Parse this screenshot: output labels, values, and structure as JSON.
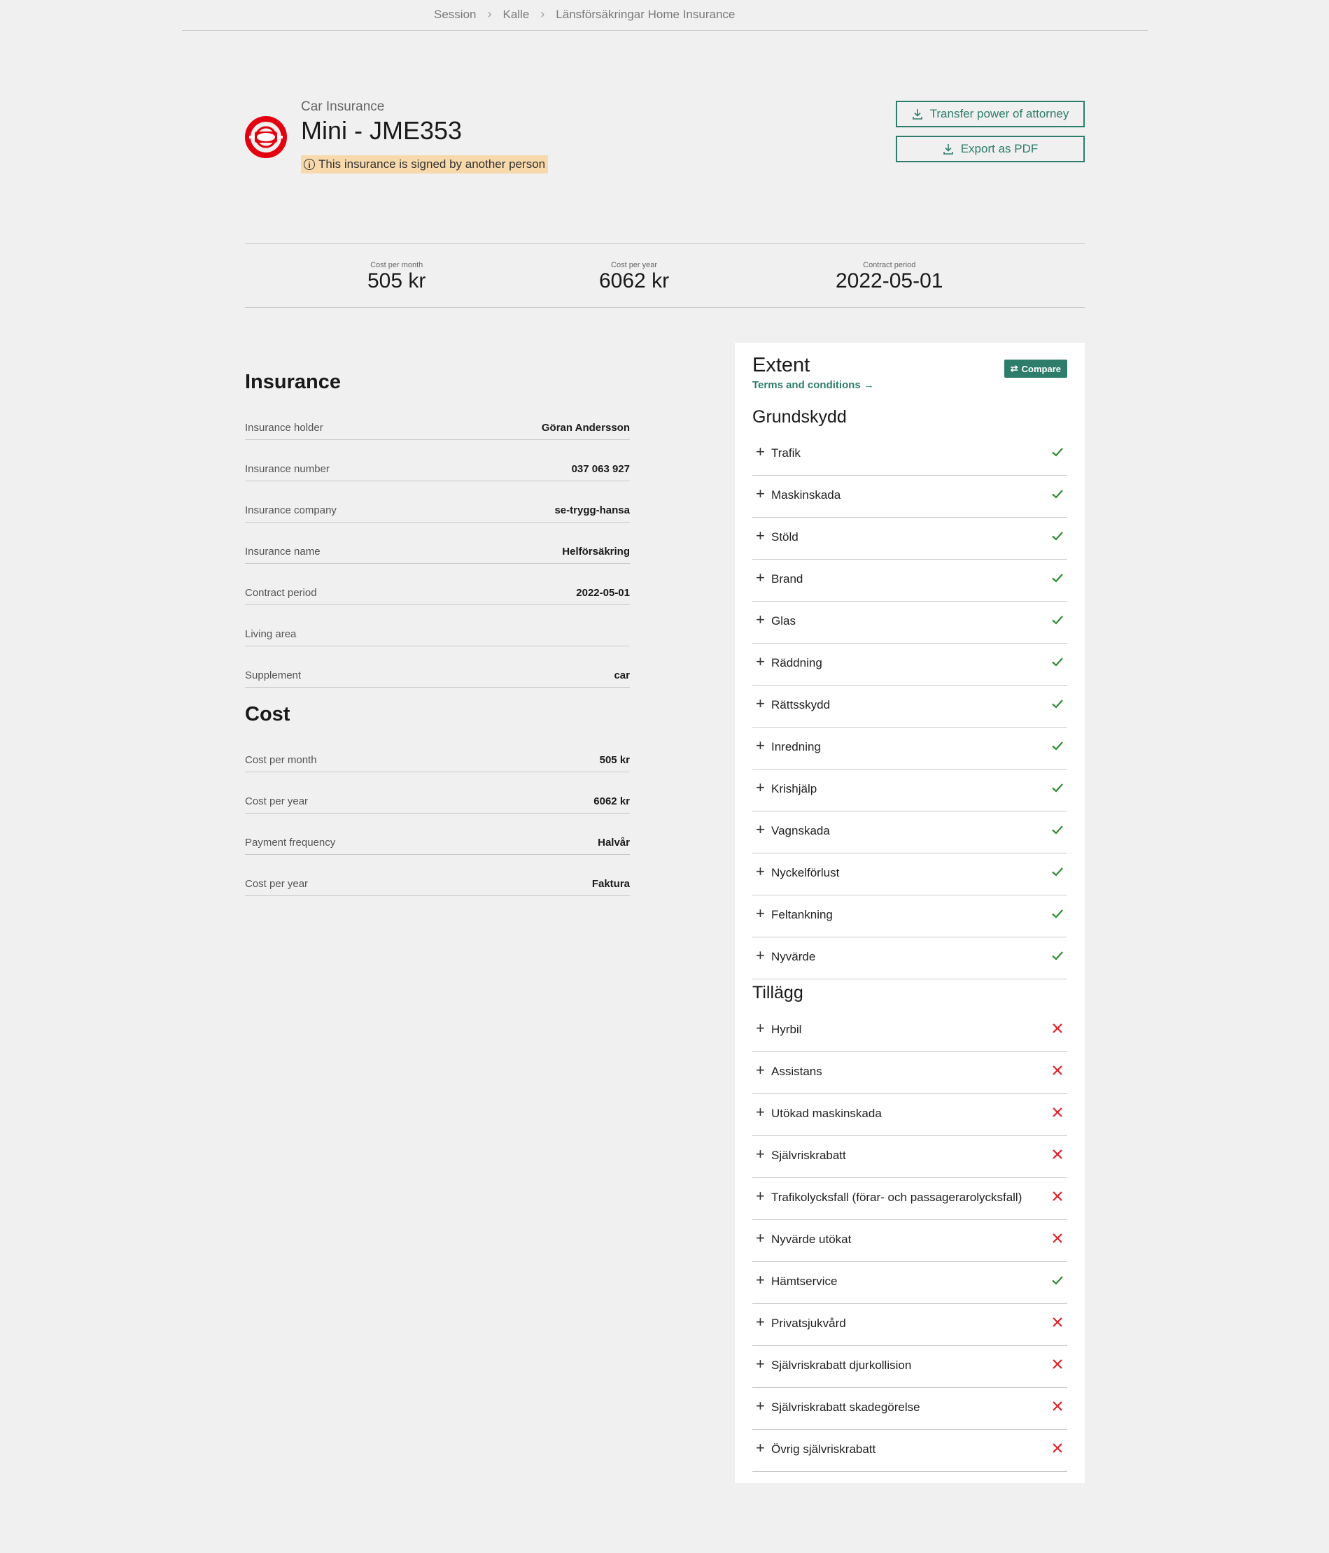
{
  "breadcrumb": {
    "items": [
      "Session",
      "Kalle",
      "Länsförsäkringar Home Insurance"
    ]
  },
  "header": {
    "category": "Car Insurance",
    "title": "Mini - JME353",
    "notice": "This insurance is signed by another person",
    "brand_color": "#e3000f",
    "buttons": {
      "transfer": "Transfer power of attorney",
      "export": "Export as PDF"
    }
  },
  "summary": {
    "month_label": "Cost per month",
    "month_value": "505 kr",
    "year_label": "Cost per year",
    "year_value": "6062 kr",
    "period_label": "Contract period",
    "period_value": "2022-05-01"
  },
  "insurance": {
    "title": "Insurance",
    "rows": [
      {
        "label": "Insurance holder",
        "value": "Göran Andersson"
      },
      {
        "label": "Insurance number",
        "value": "037 063 927"
      },
      {
        "label": "Insurance company",
        "value": "se-trygg-hansa"
      },
      {
        "label": "Insurance name",
        "value": "Helförsäkring"
      },
      {
        "label": "Contract period",
        "value": "2022-05-01"
      },
      {
        "label": "Living area",
        "value": ""
      },
      {
        "label": "Supplement",
        "value": "car"
      }
    ]
  },
  "cost": {
    "title": "Cost",
    "rows": [
      {
        "label": "Cost per month",
        "value": "505 kr"
      },
      {
        "label": "Cost per year",
        "value": "6062 kr"
      },
      {
        "label": "Payment frequency",
        "value": "Halvår"
      },
      {
        "label": "Cost per year",
        "value": "Faktura"
      }
    ]
  },
  "extent": {
    "title": "Extent",
    "terms_link": "Terms and conditions",
    "compare_label": "Compare",
    "accent_color": "#2e7d6b",
    "included_color": "#2e8b2e",
    "excluded_color": "#e0202a",
    "groups": [
      {
        "title": "Grundskydd",
        "items": [
          {
            "name": "Trafik",
            "included": true
          },
          {
            "name": "Maskinskada",
            "included": true
          },
          {
            "name": "Stöld",
            "included": true
          },
          {
            "name": "Brand",
            "included": true
          },
          {
            "name": "Glas",
            "included": true
          },
          {
            "name": "Räddning",
            "included": true
          },
          {
            "name": "Rättsskydd",
            "included": true
          },
          {
            "name": "Inredning",
            "included": true
          },
          {
            "name": "Krishjälp",
            "included": true
          },
          {
            "name": "Vagnskada",
            "included": true
          },
          {
            "name": "Nyckelförlust",
            "included": true
          },
          {
            "name": "Feltankning",
            "included": true
          },
          {
            "name": "Nyvärde",
            "included": true
          }
        ]
      },
      {
        "title": "Tillägg",
        "items": [
          {
            "name": "Hyrbil",
            "included": false
          },
          {
            "name": "Assistans",
            "included": false
          },
          {
            "name": "Utökad maskinskada",
            "included": false
          },
          {
            "name": "Självriskrabatt",
            "included": false
          },
          {
            "name": "Trafikolycksfall (förar- och passagerarolycksfall)",
            "included": false
          },
          {
            "name": "Nyvärde utökat",
            "included": false
          },
          {
            "name": "Hämtservice",
            "included": true
          },
          {
            "name": "Privatsjukvård",
            "included": false
          },
          {
            "name": "Självriskrabatt djurkollision",
            "included": false
          },
          {
            "name": "Självriskrabatt skadegörelse",
            "included": false
          },
          {
            "name": "Övrig självriskrabatt",
            "included": false
          }
        ]
      }
    ]
  }
}
